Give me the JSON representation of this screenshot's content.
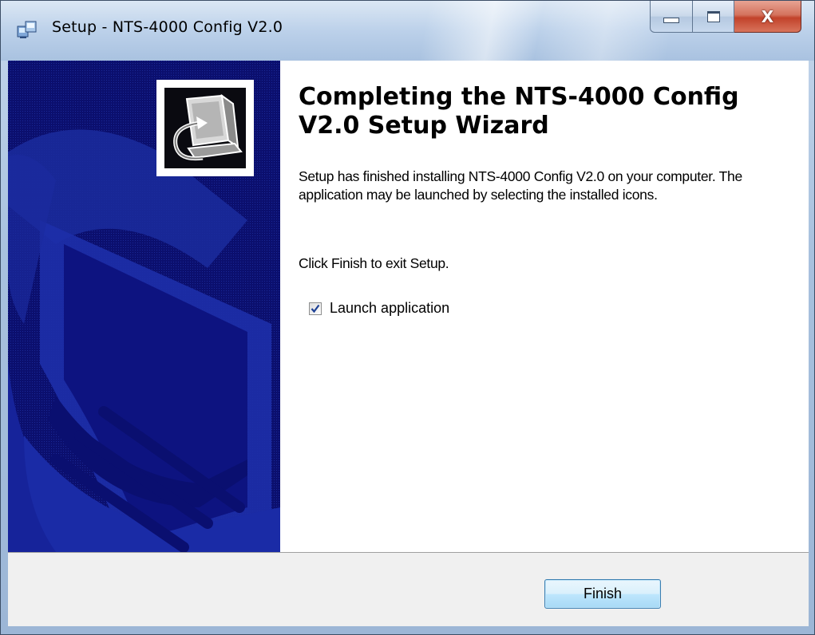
{
  "window": {
    "title": "Setup - NTS-4000 Config V2.0",
    "caption_buttons": {
      "minimize_icon": "minimize-icon",
      "maximize_icon": "maximize-icon",
      "close_label": "X"
    }
  },
  "wizard": {
    "heading": "Completing the NTS-4000 Config V2.0 Setup Wizard",
    "paragraph1": "Setup has finished installing NTS-4000 Config V2.0 on your computer. The application may be launched by selecting the installed icons.",
    "paragraph2": "Click Finish to exit Setup.",
    "launch_checkbox": {
      "label": "Launch application",
      "checked": true
    }
  },
  "footer": {
    "finish_label": "Finish"
  },
  "colors": {
    "side_panel": "#0b0f6e",
    "button_border": "#3c7fb1",
    "close_button": "#c2422a"
  },
  "icons": [
    "setup-app-icon",
    "computer-install-icon",
    "checkmark-icon"
  ]
}
